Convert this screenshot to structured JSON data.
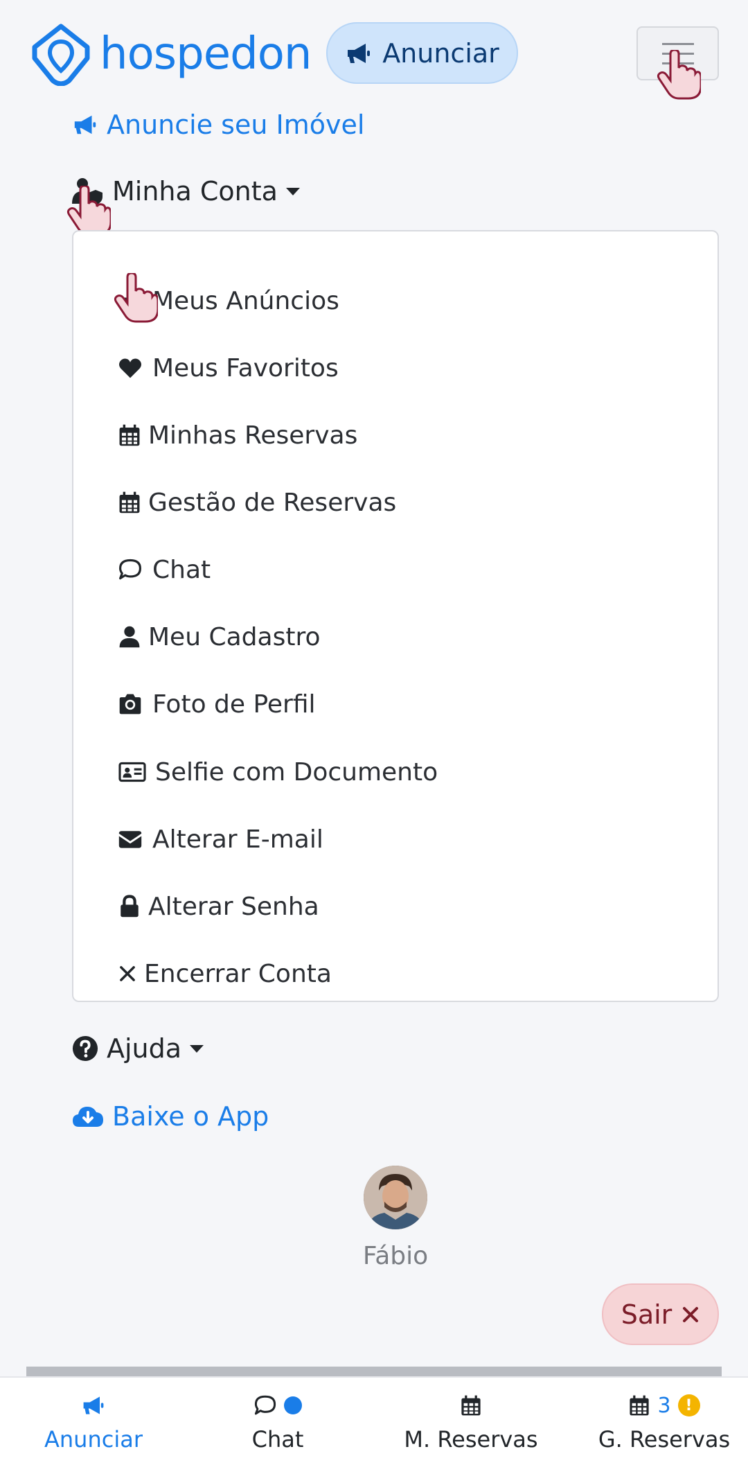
{
  "header": {
    "logo_text": "hospedon",
    "anunciar_label": "Anunciar"
  },
  "nav": {
    "anuncie_label": "Anuncie seu Imóvel",
    "minha_conta_label": "Minha Conta",
    "ajuda_label": "Ajuda",
    "baixe_app_label": "Baixe o App"
  },
  "dropdown": {
    "items": [
      {
        "label": "Meus Anúncios",
        "icon": "megaphone-icon"
      },
      {
        "label": "Meus Favoritos",
        "icon": "heart-icon"
      },
      {
        "label": "Minhas Reservas",
        "icon": "calendar-icon"
      },
      {
        "label": "Gestão de Reservas",
        "icon": "calendar-icon"
      },
      {
        "label": "Chat",
        "icon": "chat-icon"
      },
      {
        "label": "Meu Cadastro",
        "icon": "user-icon"
      },
      {
        "label": "Foto de Perfil",
        "icon": "camera-icon"
      },
      {
        "label": "Selfie com Documento",
        "icon": "id-card-icon"
      },
      {
        "label": "Alterar E-mail",
        "icon": "envelope-icon"
      },
      {
        "label": "Alterar Senha",
        "icon": "lock-icon"
      },
      {
        "label": "Encerrar Conta",
        "icon": "close-icon"
      }
    ]
  },
  "profile": {
    "name": "Fábio",
    "logout_label": "Sair"
  },
  "bottom_nav": {
    "items": [
      {
        "label": "Anunciar",
        "active": true
      },
      {
        "label": "Chat"
      },
      {
        "label": "M. Reservas"
      },
      {
        "label": "G. Reservas",
        "badge": "3",
        "warning": "!"
      }
    ]
  },
  "colors": {
    "brand": "#1a7de8",
    "danger_bg": "#f6d4d6",
    "warning": "#f4b400"
  }
}
